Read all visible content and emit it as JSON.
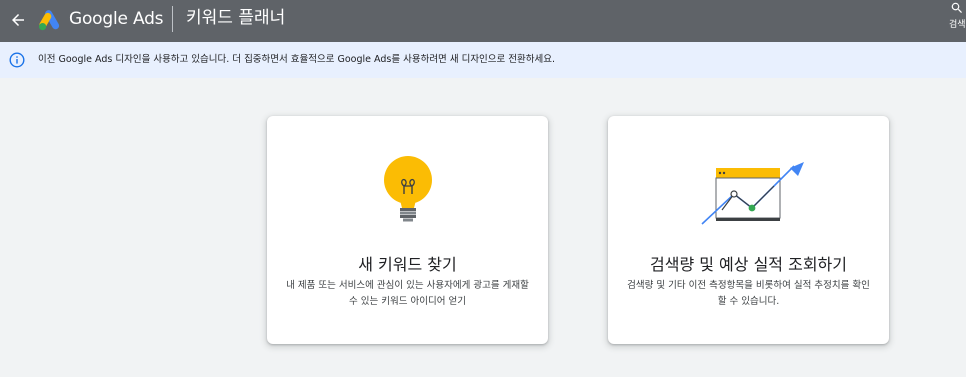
{
  "header": {
    "back_icon": "arrow-back-icon",
    "logo_icon": "google-ads-logo",
    "product_name": "Google Ads",
    "page_title": "키워드 플래너",
    "search_label": "검색",
    "background_color": "#5f6368"
  },
  "banner": {
    "icon": "info-icon",
    "text": "이전 Google Ads 디자인을 사용하고 있습니다. 더 집중하면서 효율적으로 Google Ads를 사용하려면 새 디자인으로 전환하세요.",
    "background_color": "#e8f0fe",
    "icon_color": "#1a73e8"
  },
  "cards": [
    {
      "illustration": "lightbulb-icon",
      "title": "새 키워드 찾기",
      "description": "내 제품 또는 서비스에 관심이 있는 사용자에게 광고를 게재할 수 있는 키워드 아이디어 얻기"
    },
    {
      "illustration": "trend-chart-icon",
      "title": "검색량 및 예상 실적 조회하기",
      "description": "검색량 및 기타 이전 측정항목을 비롯하여 실적 추정치를 확인할 수 있습니다."
    }
  ],
  "colors": {
    "bulb_yellow": "#fbbc04",
    "trend_blue": "#4285f4",
    "point_green": "#34a853",
    "page_background": "#f1f3f4"
  }
}
